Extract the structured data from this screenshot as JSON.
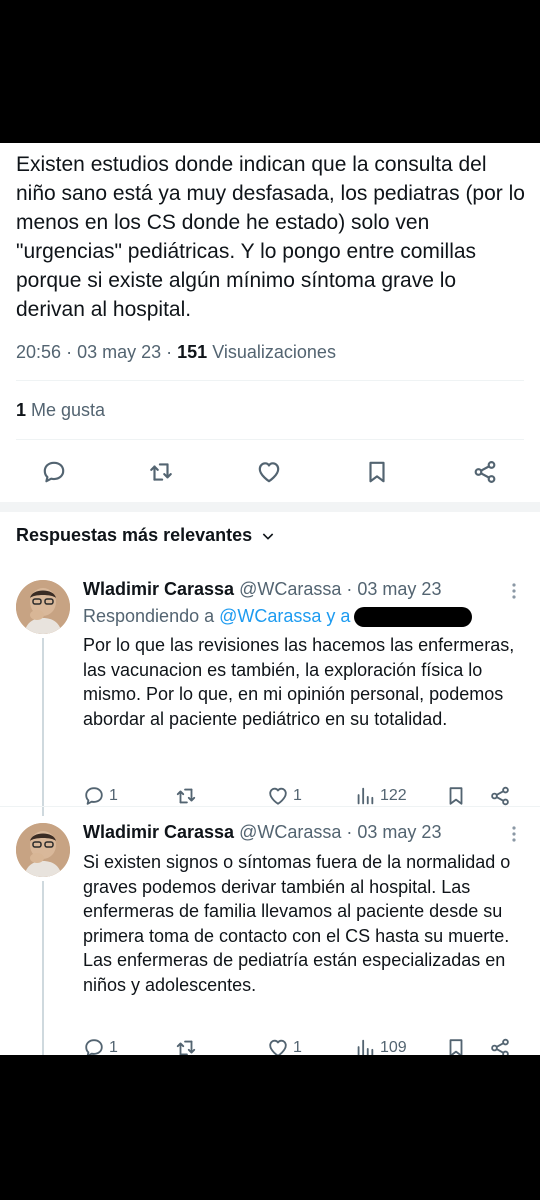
{
  "tweet": {
    "text": "Existen estudios donde indican que la consulta del niño sano está ya muy desfasada, los pediatras (por lo menos en los CS donde he estado) solo ven \"urgencias\" pediátricas. Y lo pongo entre comillas porque si existe algún mínimo síntoma grave lo derivan al hospital.",
    "time": "20:56",
    "date": "03 may 23",
    "views_count": "151",
    "views_label": "Visualizaciones",
    "likes_count": "1",
    "likes_label": "Me gusta"
  },
  "actions": [
    "reply-icon",
    "retweet-icon",
    "like-icon",
    "bookmark-icon",
    "share-icon"
  ],
  "replies_header": "Respuestas más relevantes",
  "replies": [
    {
      "name": "Wladimir Carassa",
      "handle": "@WCarassa",
      "date": "· 03 may 23",
      "replying_prefix": "Respondiendo a",
      "replying_to": "@WCarassa y a",
      "text": "Por lo que las revisiones las hacemos las enfermeras, las vacunacion es también, la exploración física lo mismo. Por lo que, en mi opinión personal, podemos abordar al paciente pediátrico en su totalidad.",
      "reply_count": "1",
      "retweet_count": "",
      "like_count": "1",
      "views": "122"
    },
    {
      "name": "Wladimir Carassa",
      "handle": "@WCarassa",
      "date": "· 03 may 23",
      "text": "Si existen signos o síntomas fuera de la normalidad o graves podemos derivar también al hospital. Las enfermeras de familia llevamos al paciente desde su primera toma de contacto con el CS hasta su muerte. Las enfermeras de pediatría están especializadas en niños y adolescentes.",
      "reply_count": "1",
      "retweet_count": "",
      "like_count": "1",
      "views": "109"
    }
  ],
  "colors": {
    "text": "#0f1419",
    "secondary": "#536471",
    "link": "#1d9bf0",
    "divider": "#eff3f4"
  }
}
